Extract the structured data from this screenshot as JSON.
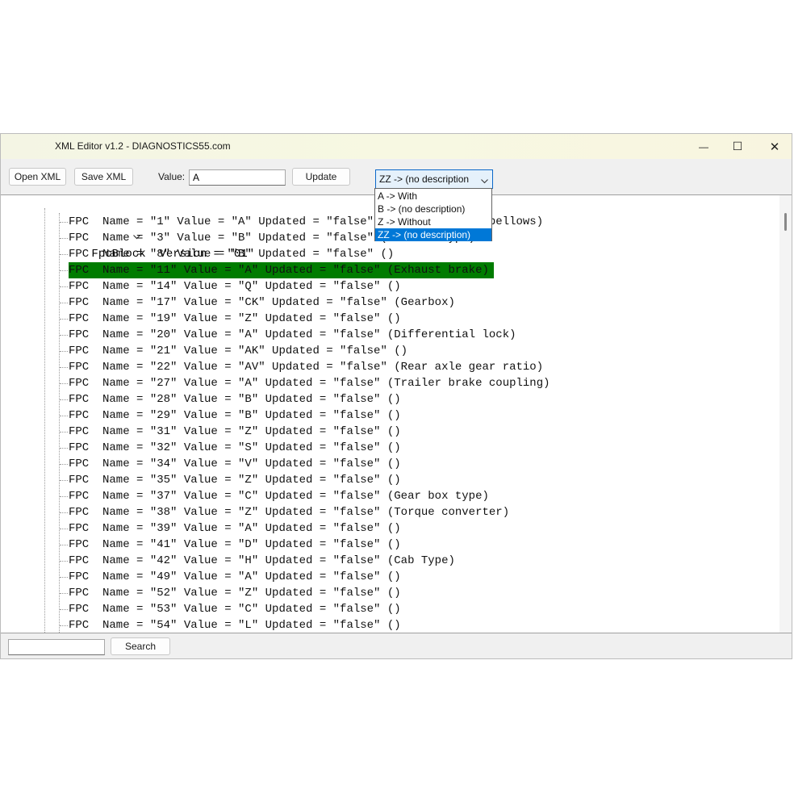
{
  "window": {
    "title": "XML Editor v1.2 - DIAGNOSTICS55.com",
    "minimize_glyph": "—",
    "maximize_glyph": "☐",
    "close_glyph": "✕"
  },
  "toolbar": {
    "open_label": "Open XML",
    "save_label": "Save XML",
    "value_label": "Value:",
    "value_input": "A",
    "update_label": "Update",
    "combo_selected": "ZZ -> (no description"
  },
  "dropdown": {
    "options": [
      "A -> With",
      "B -> (no description)",
      "Z -> Without",
      "ZZ -> (no description)"
    ],
    "highlighted_index": 3
  },
  "tree": {
    "root": "FpcBlock  Version = \"01\"",
    "selected_index": 3,
    "rows": [
      "FPC  Name = \"1\" Value = \"A\" Updated = \"false\" (Air suspension bellows)",
      "FPC  Name = \"3\" Value = \"B\" Updated = \"false\" (Chassis type)",
      "FPC  Name = \"8\" Value = \"B\" Updated = \"false\" ()",
      "FPC  Name = \"11\" Value = \"A\" Updated = \"false\" (Exhaust brake)",
      "FPC  Name = \"14\" Value = \"Q\" Updated = \"false\" ()",
      "FPC  Name = \"17\" Value = \"CK\" Updated = \"false\" (Gearbox)",
      "FPC  Name = \"19\" Value = \"Z\" Updated = \"false\" ()",
      "FPC  Name = \"20\" Value = \"A\" Updated = \"false\" (Differential lock)",
      "FPC  Name = \"21\" Value = \"AK\" Updated = \"false\" ()",
      "FPC  Name = \"22\" Value = \"AV\" Updated = \"false\" (Rear axle gear ratio)",
      "FPC  Name = \"27\" Value = \"A\" Updated = \"false\" (Trailer brake coupling)",
      "FPC  Name = \"28\" Value = \"B\" Updated = \"false\" ()",
      "FPC  Name = \"29\" Value = \"B\" Updated = \"false\" ()",
      "FPC  Name = \"31\" Value = \"Z\" Updated = \"false\" ()",
      "FPC  Name = \"32\" Value = \"S\" Updated = \"false\" ()",
      "FPC  Name = \"34\" Value = \"V\" Updated = \"false\" ()",
      "FPC  Name = \"35\" Value = \"Z\" Updated = \"false\" ()",
      "FPC  Name = \"37\" Value = \"C\" Updated = \"false\" (Gear box type)",
      "FPC  Name = \"38\" Value = \"Z\" Updated = \"false\" (Torque converter)",
      "FPC  Name = \"39\" Value = \"A\" Updated = \"false\" ()",
      "FPC  Name = \"41\" Value = \"D\" Updated = \"false\" ()",
      "FPC  Name = \"42\" Value = \"H\" Updated = \"false\" (Cab Type)",
      "FPC  Name = \"49\" Value = \"A\" Updated = \"false\" ()",
      "FPC  Name = \"52\" Value = \"Z\" Updated = \"false\" ()",
      "FPC  Name = \"53\" Value = \"C\" Updated = \"false\" ()",
      "FPC  Name = \"54\" Value = \"L\" Updated = \"false\" ()"
    ]
  },
  "bottom": {
    "search_input": "",
    "search_label": "Search"
  }
}
